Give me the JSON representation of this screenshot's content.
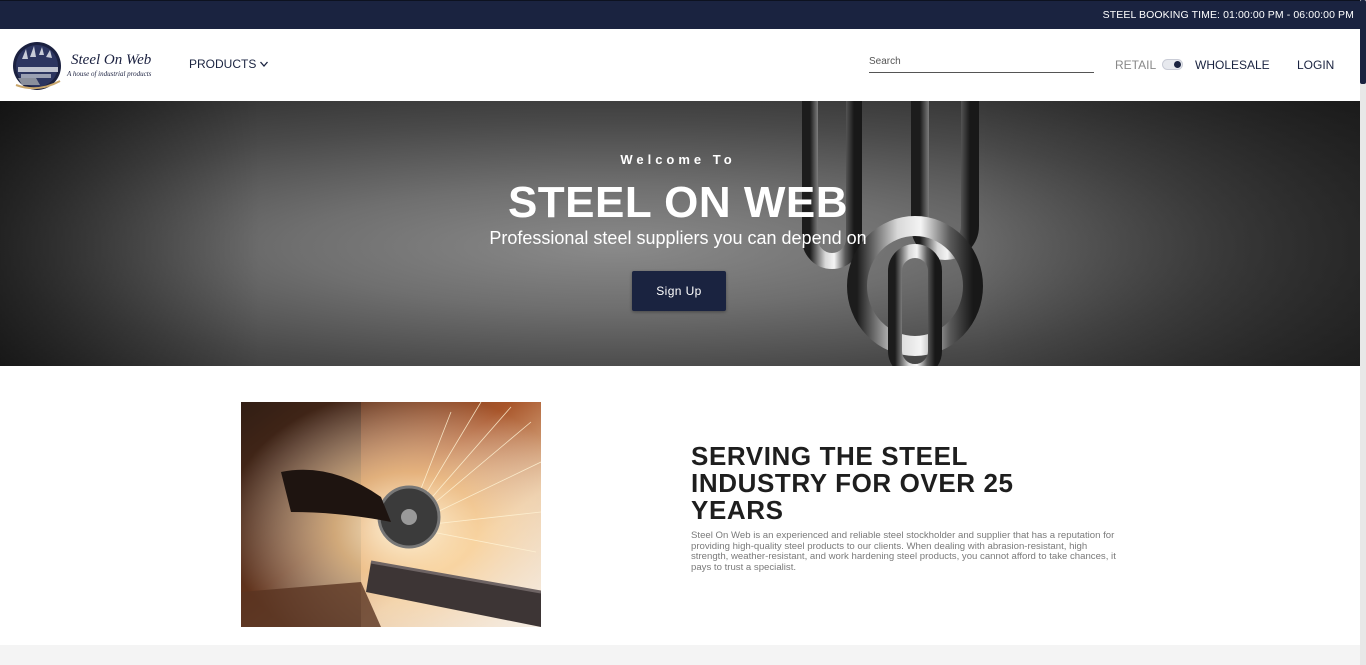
{
  "topbar": {
    "booking_time": "STEEL BOOKING TIME: 01:00:00 PM - 06:00:00 PM"
  },
  "header": {
    "logo_name": "Steel On Web",
    "logo_tagline": "A house of industrial products",
    "products_label": "PRODUCTS",
    "search_placeholder": "Search",
    "retail_label": "RETAIL",
    "wholesale_label": "WHOLESALE",
    "login_label": "LOGIN",
    "mode_toggle_on": true
  },
  "hero": {
    "welcome": "Welcome To",
    "title": "STEEL ON WEB",
    "subtitle": "Professional steel suppliers you can depend on",
    "signup_label": "Sign Up"
  },
  "about": {
    "title": "SERVING THE STEEL INDUSTRY FOR OVER 25 YEARS",
    "text": "Steel On Web is an experienced and reliable steel stockholder and supplier that has a reputation for providing high-quality steel products to our clients. When dealing with abrasion-resistant, high strength, weather-resistant, and work hardening steel products, you cannot afford to take chances, it pays to trust a specialist."
  },
  "colors": {
    "brand_navy": "#1a2340",
    "muted_text": "#7a7a7a"
  },
  "icons": {
    "products_dropdown": "chevron-down-icon",
    "logo": "steel-on-web-logo"
  }
}
